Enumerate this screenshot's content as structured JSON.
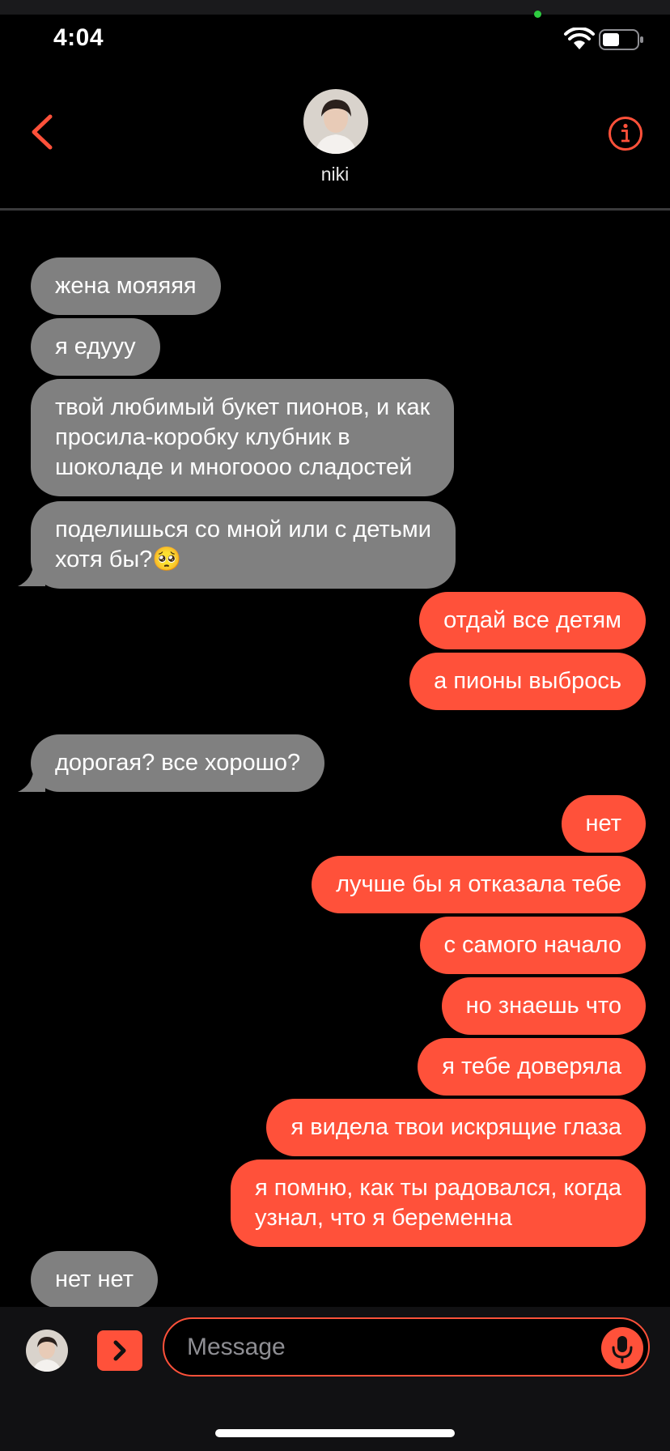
{
  "status_bar": {
    "time": "4:04"
  },
  "header": {
    "contact_name": "niki"
  },
  "messages": [
    {
      "side": "in",
      "text": "жена мояяяя"
    },
    {
      "side": "in",
      "text": "я едууу"
    },
    {
      "side": "in",
      "lines": [
        "твой любимый букет пионов, и как",
        "просила-коробку клубник в",
        "шоколаде и многоооо сладостей"
      ]
    },
    {
      "side": "in",
      "lines": [
        "поделишься со мной или с детьми",
        "хотя бы?"
      ],
      "emoji": "🥺"
    },
    {
      "side": "out",
      "text": "отдай все детям"
    },
    {
      "side": "out",
      "text": "а пионы выбрось"
    },
    {
      "side": "in",
      "text": "дорогая? все хорошо?"
    },
    {
      "side": "out",
      "text": "нет"
    },
    {
      "side": "out",
      "text": "лучше бы я отказала тебе"
    },
    {
      "side": "out",
      "text": "с самого начало"
    },
    {
      "side": "out",
      "text": "но знаешь что"
    },
    {
      "side": "out",
      "text": "я тебе доверяла"
    },
    {
      "side": "out",
      "text": "я видела твои искрящие глаза"
    },
    {
      "side": "out",
      "lines": [
        "я помню, как ты радовался, когда",
        "узнал, что я беременна"
      ]
    },
    {
      "side": "in",
      "text": "нет нет"
    }
  ],
  "composer": {
    "placeholder": "Message"
  },
  "icons": {
    "back": "chevron-left-icon",
    "info": "info-icon",
    "expand": "chevron-right-icon",
    "mic": "microphone-icon",
    "wifi": "wifi-icon",
    "battery": "battery-icon"
  },
  "colors": {
    "accent": "#ff513a",
    "incoming_bubble": "#808080",
    "background": "#000000"
  }
}
